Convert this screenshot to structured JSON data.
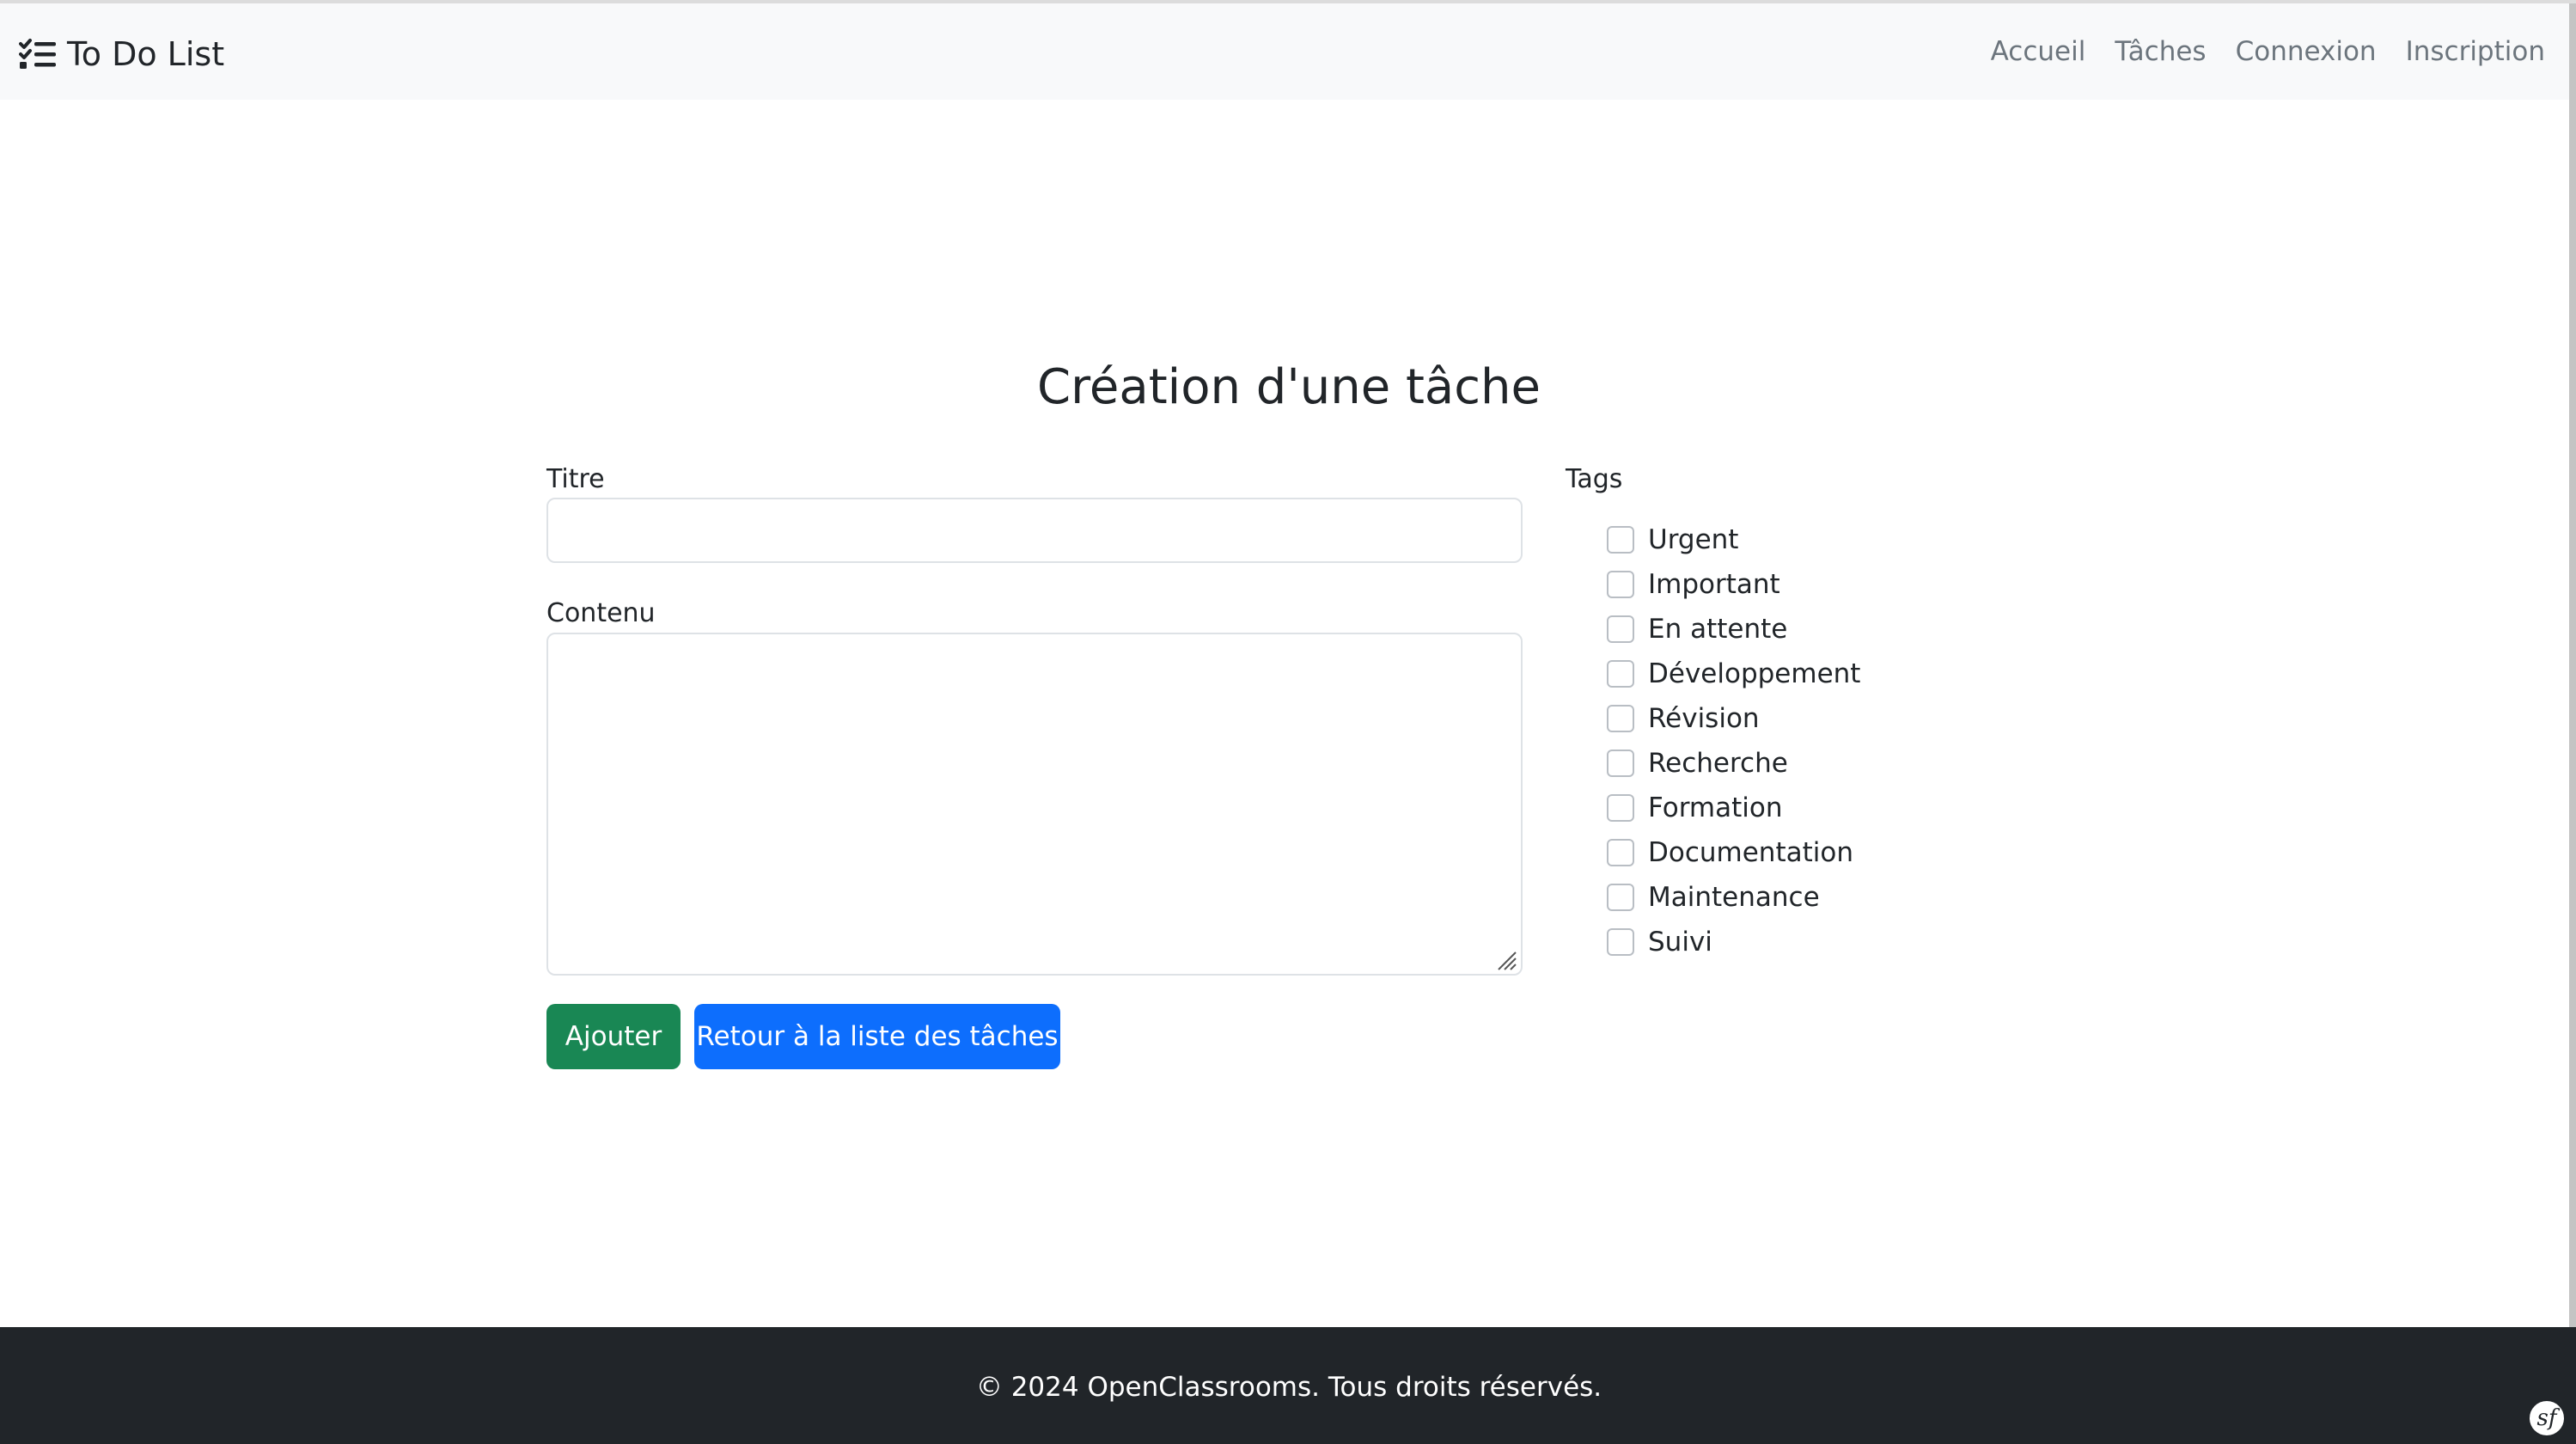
{
  "navbar": {
    "brand": "To Do List",
    "brand_icon": "list-check-icon",
    "links": [
      "Accueil",
      "Tâches",
      "Connexion",
      "Inscription"
    ]
  },
  "main": {
    "title": "Création d'une tâche",
    "form": {
      "title_label": "Titre",
      "title_value": "",
      "content_label": "Contenu",
      "content_value": "",
      "tags_label": "Tags",
      "tags": [
        {
          "label": "Urgent",
          "checked": false
        },
        {
          "label": "Important",
          "checked": false
        },
        {
          "label": "En attente",
          "checked": false
        },
        {
          "label": "Développement",
          "checked": false
        },
        {
          "label": "Révision",
          "checked": false
        },
        {
          "label": "Recherche",
          "checked": false
        },
        {
          "label": "Formation",
          "checked": false
        },
        {
          "label": "Documentation",
          "checked": false
        },
        {
          "label": "Maintenance",
          "checked": false
        },
        {
          "label": "Suivi",
          "checked": false
        }
      ],
      "submit_label": "Ajouter",
      "back_label": "Retour à la liste des tâches"
    }
  },
  "footer": {
    "text": "© 2024 OpenClassrooms. Tous droits réservés.",
    "badge_icon": "symfony-icon"
  },
  "colors": {
    "navbar_bg": "#f8f9fa",
    "success": "#198754",
    "primary": "#0d6efd",
    "footer_bg": "#212529"
  }
}
